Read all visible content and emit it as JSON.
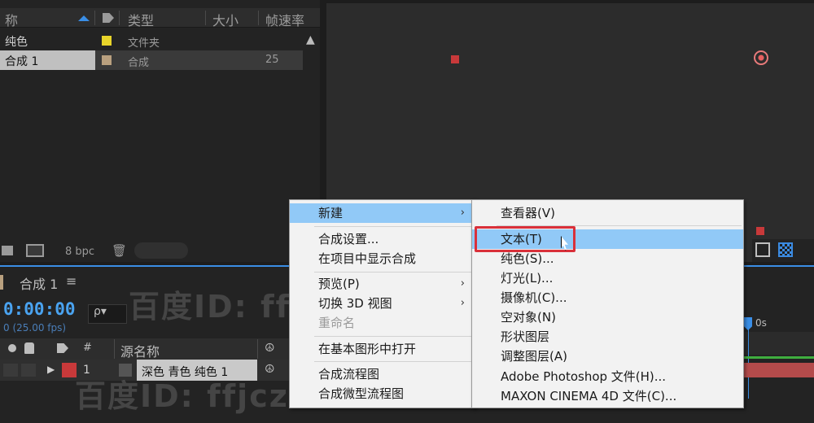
{
  "project": {
    "headers": {
      "name": "称",
      "type": "类型",
      "size": "大小",
      "fps": "帧速率"
    },
    "rows": [
      {
        "name": "纯色",
        "type": "文件夹",
        "fps": "",
        "swatch": "#e8d42a",
        "selected": false
      },
      {
        "name": "合成 1",
        "type": "合成",
        "fps": "25",
        "swatch": "#b9a07f",
        "selected": true
      }
    ],
    "footer": {
      "bpc": "8 bpc"
    }
  },
  "timeline": {
    "tab_label": "合成 1",
    "tab_menu": "≡",
    "timecode": "0:00:00",
    "fps_label": "0 (25.00 fps)",
    "search_glyph": "ρ▾",
    "header": {
      "hash": "#",
      "source_name": "源名称"
    },
    "layer": {
      "index": "1",
      "name": "深色 青色 纯色 1"
    },
    "ruler_label": "0s"
  },
  "menu_main": {
    "items": [
      {
        "label": "新建",
        "arrow": "›",
        "highlight": true
      },
      {
        "label": "合成设置..."
      },
      {
        "label": "在项目中显示合成"
      },
      {
        "label": "预览(P)",
        "arrow": "›"
      },
      {
        "label": "切换 3D 视图",
        "arrow": "›"
      },
      {
        "label": "重命名",
        "disabled": true
      },
      {
        "label": "在基本图形中打开"
      },
      {
        "label": "合成流程图"
      },
      {
        "label": "合成微型流程图"
      }
    ]
  },
  "menu_sub": {
    "items": [
      {
        "label": "查看器(V)"
      },
      {
        "label": "文本(T)",
        "highlight": true
      },
      {
        "label": "纯色(S)..."
      },
      {
        "label": "灯光(L)..."
      },
      {
        "label": "摄像机(C)..."
      },
      {
        "label": "空对象(N)"
      },
      {
        "label": "形状图层"
      },
      {
        "label": "调整图层(A)"
      },
      {
        "label": "Adobe Photoshop 文件(H)..."
      },
      {
        "label": "MAXON CINEMA 4D 文件(C)..."
      }
    ]
  },
  "watermark": {
    "text": "百度ID: ffjczr"
  },
  "colors": {
    "accent": "#3a8ee6",
    "menu_highlight": "#91c9f7",
    "annotation_red": "#d9303a",
    "layer_red": "#c8393a"
  }
}
